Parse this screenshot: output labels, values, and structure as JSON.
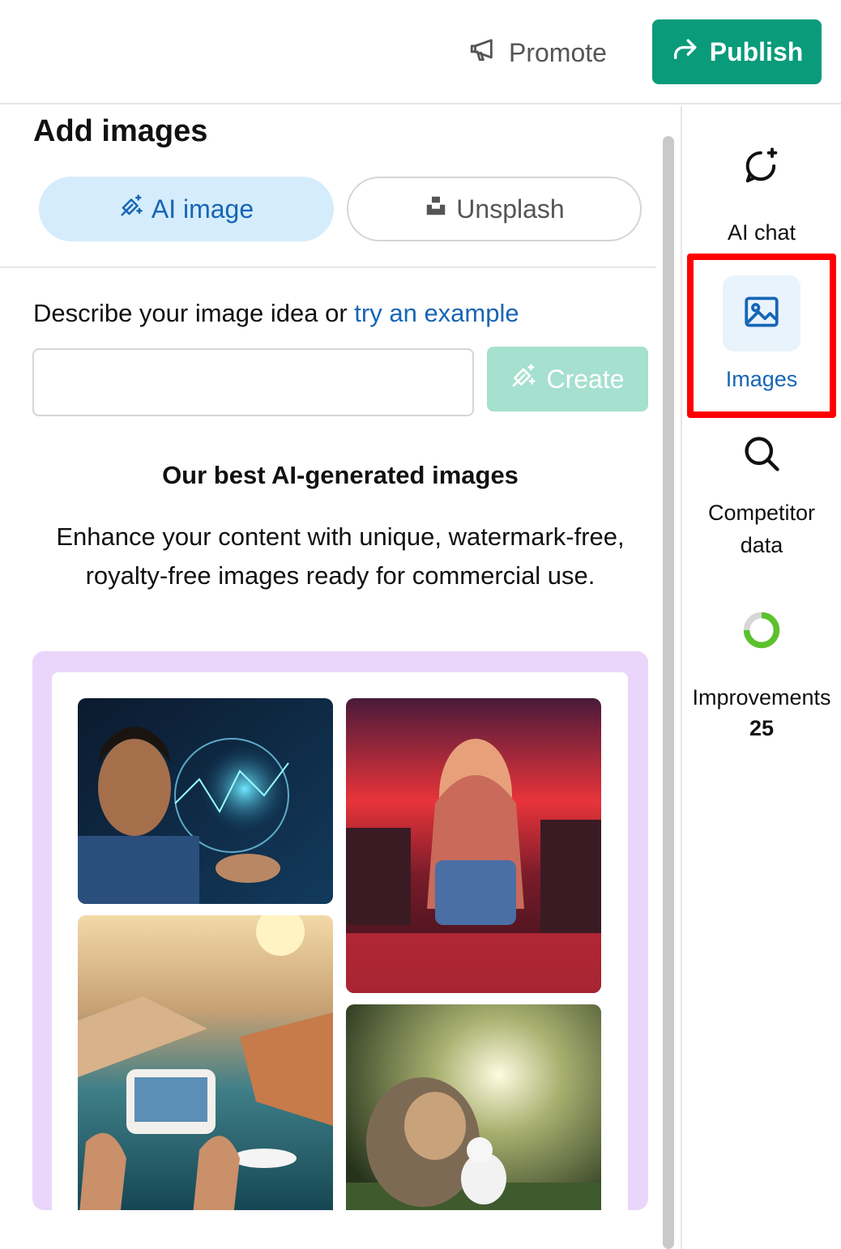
{
  "header": {
    "promote_label": "Promote",
    "publish_label": "Publish"
  },
  "panel": {
    "title": "Add images",
    "tabs": [
      {
        "label": "AI image",
        "icon": "magic-wand-icon",
        "active": true
      },
      {
        "label": "Unsplash",
        "icon": "unsplash-icon",
        "active": false
      }
    ],
    "prompt_label": "Describe your image idea or ",
    "prompt_link": "try an example",
    "prompt_value": "",
    "create_label": "Create",
    "best_title": "Our best AI-generated images",
    "best_description": "Enhance your content with unique, watermark-free, royalty-free images ready for commercial use."
  },
  "sidebar": {
    "items": [
      {
        "label": "AI chat",
        "icon": "chat-sparkle-icon"
      },
      {
        "label": "Images",
        "icon": "image-icon",
        "active": true
      },
      {
        "label": "Competitor data",
        "icon": "search-icon"
      },
      {
        "label": "Improvements",
        "icon": "progress-ring-icon",
        "count": "25"
      }
    ]
  },
  "colors": {
    "accent": "#1765b5",
    "publish": "#0a9b7b",
    "create_disabled": "#a6e0cf",
    "tab_active_bg": "#d4ecfb",
    "gallery_bg": "#ead6fa",
    "highlight": "#ff0000"
  }
}
